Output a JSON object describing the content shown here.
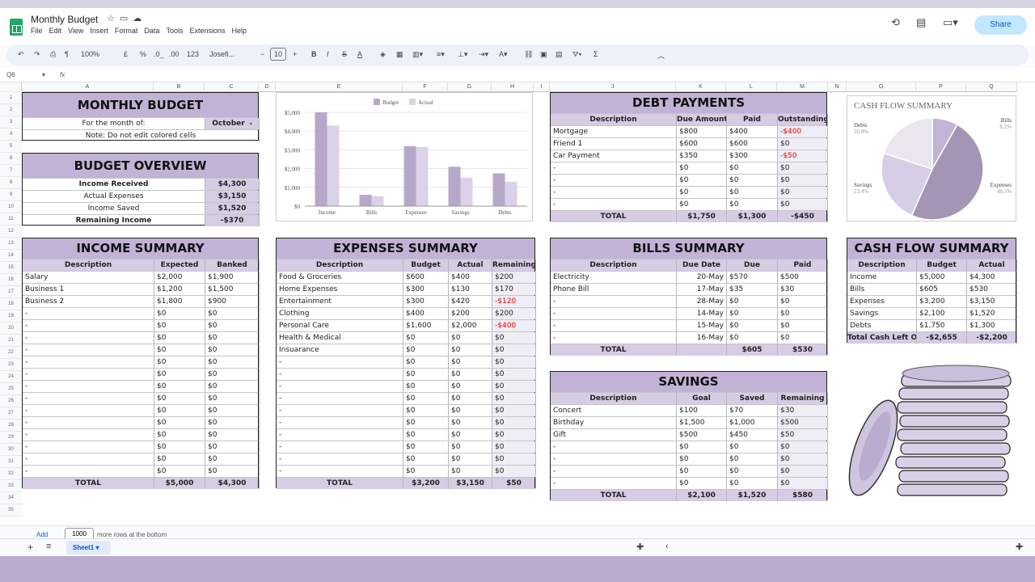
{
  "app": {
    "title": "Monthly Budget",
    "menu": [
      "File",
      "Edit",
      "View",
      "Insert",
      "Format",
      "Data",
      "Tools",
      "Extensions",
      "Help"
    ],
    "share": "Share"
  },
  "toolbar": {
    "zoom": "100%",
    "currency": "£",
    "percent": "%",
    "dec_less": ".0_",
    "dec_more": ".00",
    "num_format": "123",
    "font": "Josefi...",
    "font_size": "10"
  },
  "formula": {
    "cell": "Q6",
    "fx": "fx"
  },
  "columns": [
    "A",
    "B",
    "C",
    "D",
    "E",
    "F",
    "G",
    "H",
    "I",
    "J",
    "K",
    "L",
    "M",
    "N",
    "O",
    "P",
    "Q"
  ],
  "rows": [
    "1",
    "2",
    "3",
    "4",
    "5",
    "6",
    "7",
    "8",
    "9",
    "10",
    "11",
    "12",
    "13",
    "14",
    "15",
    "16",
    "17",
    "18",
    "19",
    "20",
    "21",
    "22",
    "23",
    "24",
    "25",
    "26",
    "27",
    "28",
    "29",
    "30",
    "31",
    "32",
    "33",
    "34",
    "35"
  ],
  "monthly": {
    "title": "MONTHLY BUDGET",
    "month_label": "For the month of:",
    "month_value": "October",
    "note": "Note: Do not edit colored cells"
  },
  "overview": {
    "title": "BUDGET OVERVIEW",
    "rows": [
      [
        "Income Received",
        "$4,300"
      ],
      [
        "Actual Expenses",
        "$3,150"
      ],
      [
        "Income Saved",
        "$1,520"
      ],
      [
        "Remaining Income",
        "-$370"
      ]
    ]
  },
  "income": {
    "title": "INCOME SUMMARY",
    "headers": [
      "Description",
      "Expected",
      "Banked"
    ],
    "rows": [
      [
        "Salary",
        "$2,000",
        "$1,900"
      ],
      [
        "Business 1",
        "$1,200",
        "$1,500"
      ],
      [
        "Business 2",
        "$1,800",
        "$900"
      ],
      [
        "-",
        "$0",
        "$0"
      ],
      [
        "-",
        "$0",
        "$0"
      ],
      [
        "-",
        "$0",
        "$0"
      ],
      [
        "-",
        "$0",
        "$0"
      ],
      [
        "-",
        "$0",
        "$0"
      ],
      [
        "-",
        "$0",
        "$0"
      ],
      [
        "-",
        "$0",
        "$0"
      ],
      [
        "-",
        "$0",
        "$0"
      ],
      [
        "-",
        "$0",
        "$0"
      ],
      [
        "-",
        "$0",
        "$0"
      ],
      [
        "-",
        "$0",
        "$0"
      ],
      [
        "-",
        "$0",
        "$0"
      ],
      [
        "-",
        "$0",
        "$0"
      ],
      [
        "-",
        "$0",
        "$0"
      ]
    ],
    "total": [
      "TOTAL",
      "$5,000",
      "$4,300"
    ]
  },
  "expenses": {
    "title": "EXPENSES SUMMARY",
    "headers": [
      "Description",
      "Budget",
      "Actual",
      "Remaining"
    ],
    "rows": [
      [
        "Food & Groceries",
        "$600",
        "$400",
        "$200"
      ],
      [
        "Home Expenses",
        "$300",
        "$130",
        "$170"
      ],
      [
        "Entertainment",
        "$300",
        "$420",
        "-$120"
      ],
      [
        "Clothing",
        "$400",
        "$200",
        "$200"
      ],
      [
        "Personal Care",
        "$1,600",
        "$2,000",
        "-$400"
      ],
      [
        "Health & Medical",
        "$0",
        "$0",
        "$0"
      ],
      [
        "Insuarance",
        "$0",
        "$0",
        "$0"
      ],
      [
        "-",
        "$0",
        "$0",
        "$0"
      ],
      [
        "-",
        "$0",
        "$0",
        "$0"
      ],
      [
        "-",
        "$0",
        "$0",
        "$0"
      ],
      [
        "-",
        "$0",
        "$0",
        "$0"
      ],
      [
        "-",
        "$0",
        "$0",
        "$0"
      ],
      [
        "-",
        "$0",
        "$0",
        "$0"
      ],
      [
        "-",
        "$0",
        "$0",
        "$0"
      ],
      [
        "-",
        "$0",
        "$0",
        "$0"
      ],
      [
        "-",
        "$0",
        "$0",
        "$0"
      ],
      [
        "-",
        "$0",
        "$0",
        "$0"
      ]
    ],
    "total": [
      "TOTAL",
      "$3,200",
      "$3,150",
      "$50"
    ]
  },
  "debt": {
    "title": "DEBT PAYMENTS",
    "headers": [
      "Description",
      "Due Amount",
      "Paid",
      "Outstanding"
    ],
    "rows": [
      [
        "Mortgage",
        "$800",
        "$400",
        "-$400"
      ],
      [
        "Friend 1",
        "$600",
        "$600",
        "$0"
      ],
      [
        "Car Payment",
        "$350",
        "$300",
        "-$50"
      ],
      [
        "-",
        "$0",
        "$0",
        "$0"
      ],
      [
        "-",
        "$0",
        "$0",
        "$0"
      ],
      [
        "-",
        "$0",
        "$0",
        "$0"
      ],
      [
        "-",
        "$0",
        "$0",
        "$0"
      ]
    ],
    "total": [
      "TOTAL",
      "$1,750",
      "$1,300",
      "-$450"
    ]
  },
  "bills": {
    "title": "BILLS SUMMARY",
    "headers": [
      "Description",
      "Due Date",
      "Due",
      "Paid"
    ],
    "rows": [
      [
        "Electricity",
        "20-May",
        "$570",
        "$500"
      ],
      [
        "Phone Bill",
        "17-May",
        "$35",
        "$30"
      ],
      [
        "-",
        "28-May",
        "$0",
        "$0"
      ],
      [
        "-",
        "14-May",
        "$0",
        "$0"
      ],
      [
        "-",
        "15-May",
        "$0",
        "$0"
      ],
      [
        "-",
        "16-May",
        "$0",
        "$0"
      ]
    ],
    "total": [
      "TOTAL",
      "",
      "$605",
      "$530"
    ]
  },
  "savings": {
    "title": "SAVINGS",
    "headers": [
      "Description",
      "Goal",
      "Saved",
      "Remaining"
    ],
    "rows": [
      [
        "Concert",
        "$100",
        "$70",
        "$30"
      ],
      [
        "Birthday",
        "$1,500",
        "$1,000",
        "$500"
      ],
      [
        "Gift",
        "$500",
        "$450",
        "$50"
      ],
      [
        "-",
        "$0",
        "$0",
        "$0"
      ],
      [
        "-",
        "$0",
        "$0",
        "$0"
      ],
      [
        "-",
        "$0",
        "$0",
        "$0"
      ],
      [
        "-",
        "$0",
        "$0",
        "$0"
      ]
    ],
    "total": [
      "TOTAL",
      "$2,100",
      "$1,520",
      "$580"
    ]
  },
  "cashflow": {
    "title": "CASH FLOW SUMMARY",
    "headers": [
      "Description",
      "Budget",
      "Actual"
    ],
    "rows": [
      [
        "Income",
        "$5,000",
        "$4,300"
      ],
      [
        "Bills",
        "$605",
        "$530"
      ],
      [
        "Expenses",
        "$3,200",
        "$3,150"
      ],
      [
        "Savings",
        "$2,100",
        "$1,520"
      ],
      [
        "Debts",
        "$1,750",
        "$1,300"
      ]
    ],
    "total": [
      "Total Cash Left Ov",
      "-$2,655",
      "-$2,200"
    ]
  },
  "chart_data": [
    {
      "type": "bar",
      "categories": [
        "Income",
        "Bills",
        "Expenses",
        "Savings",
        "Debts"
      ],
      "series": [
        {
          "name": "Budget",
          "values": [
            5000,
            605,
            3200,
            2100,
            1750
          ],
          "color": "#b7a8c9"
        },
        {
          "name": "Actual",
          "values": [
            4300,
            530,
            3150,
            1520,
            1300
          ],
          "color": "#dcd1ea"
        }
      ],
      "yticks": [
        "$0",
        "$1,000",
        "$2,000",
        "$3,000",
        "$4,000",
        "$5,000"
      ],
      "ylim": [
        0,
        5000
      ],
      "legend": "top"
    },
    {
      "type": "pie",
      "title": "CASH FLOW SUMMARY",
      "slices": [
        {
          "label": "Expenses",
          "value": 48.5,
          "pct": "48.5%",
          "color": "#a395b3"
        },
        {
          "label": "Savings",
          "value": 23.4,
          "pct": "23.4%",
          "color": "#d8cde6"
        },
        {
          "label": "Debts",
          "value": 20.0,
          "pct": "20.0%",
          "color": "#eae6f0"
        },
        {
          "label": "Bills",
          "value": 8.2,
          "pct": "8.2%",
          "color": "#c3b4d5"
        }
      ]
    }
  ],
  "bottom": {
    "add": "Add",
    "add_count": "1000",
    "add_suffix": "more rows at the bottom",
    "sheet_tab": "Sheet1"
  }
}
